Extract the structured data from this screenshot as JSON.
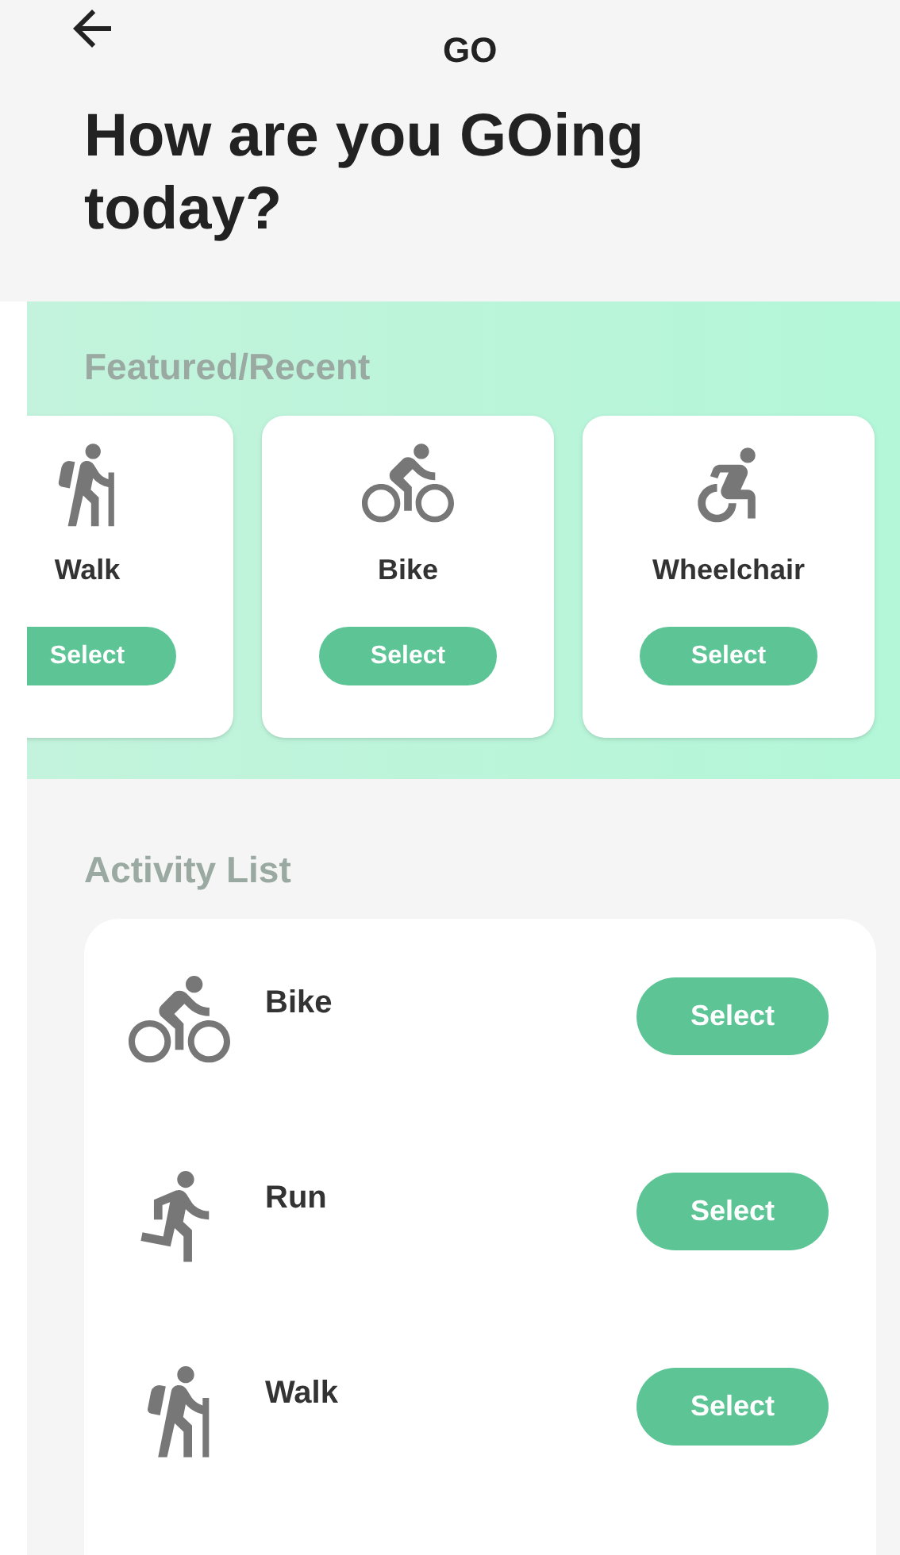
{
  "header": {
    "title": "GO"
  },
  "heading": "How are you GOing today?",
  "featured": {
    "title": "Featured/Recent",
    "items": [
      {
        "kind": "walk",
        "label": "Walk",
        "button": "Select"
      },
      {
        "kind": "bike",
        "label": "Bike",
        "button": "Select"
      },
      {
        "kind": "wheelchair",
        "label": "Wheelchair",
        "button": "Select"
      }
    ]
  },
  "activity_list": {
    "title": "Activity List",
    "items": [
      {
        "kind": "bike",
        "label": "Bike",
        "button": "Select"
      },
      {
        "kind": "run",
        "label": "Run",
        "button": "Select"
      },
      {
        "kind": "walk",
        "label": "Walk",
        "button": "Select"
      }
    ]
  }
}
